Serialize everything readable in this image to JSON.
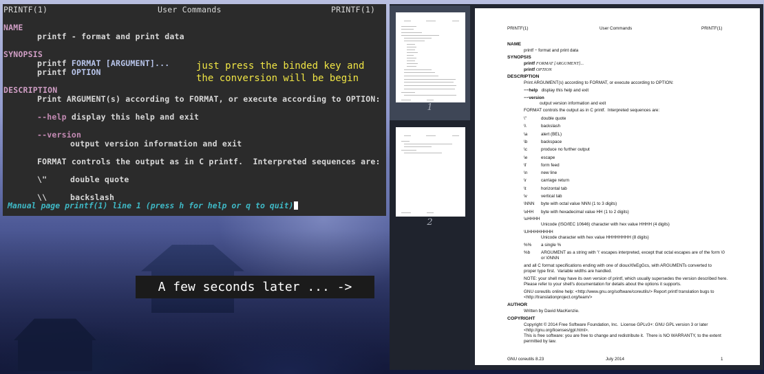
{
  "terminal": {
    "header_left": "PRINTF(1)",
    "header_mid": "User Commands",
    "header_right": "PRINTF(1)",
    "name_heading": "NAME",
    "name_text": "printf - format and print data",
    "synopsis_heading": "SYNOPSIS",
    "synopsis_cmd1": "printf",
    "synopsis_arg1a": "FORMAT",
    "synopsis_arg1b": "[ARGUMENT]...",
    "synopsis_cmd2": "printf",
    "synopsis_arg2": "OPTION",
    "description_heading": "DESCRIPTION",
    "description_text": "Print ARGUMENT(s) according to FORMAT, or execute according to OPTION:",
    "help_opt": "--help",
    "help_text": "display this help and exit",
    "version_opt": "--version",
    "version_text": "output version information and exit",
    "format_text": "FORMAT controls the output as in C printf.  Interpreted sequences are:",
    "seq1_code": "\\\"",
    "seq1_text": "double quote",
    "seq2_code": "\\\\",
    "seq2_text": "backslash",
    "status": "Manual page printf(1) line 1 (press h for help or q to quit)"
  },
  "overlay_note": "just press the binded key and\nthe conversion will be begin",
  "later_banner": "A few seconds later ... ->",
  "viewer": {
    "thumb1_label": "1",
    "thumb2_label": "2",
    "page": {
      "header_left": "PRINTF(1)",
      "header_mid": "User Commands",
      "header_right": "PRINTF(1)",
      "name_h": "NAME",
      "name_t": "printf − format and print data",
      "syn_h": "SYNOPSIS",
      "syn_1a": "printf",
      "syn_1b": "FORMAT [ARGUMENT]...",
      "syn_2a": "printf",
      "syn_2b": "OPTION",
      "desc_h": "DESCRIPTION",
      "desc_t": "Print ARGUMENT(s) according to FORMAT, or execute according to OPTION:",
      "help_o": "−−help",
      "help_t": "display this help and exit",
      "ver_o": "−−version",
      "ver_t": "output version information and exit",
      "fmt_t": "FORMAT controls the output as in C printf.  Interpreted sequences are:",
      "seqs": [
        {
          "code": "\\\"",
          "text": "double quote"
        },
        {
          "code": "\\\\",
          "text": "backslash"
        },
        {
          "code": "\\a",
          "text": "alert (BEL)"
        },
        {
          "code": "\\b",
          "text": "backspace"
        },
        {
          "code": "\\c",
          "text": "produce no further output"
        },
        {
          "code": "\\e",
          "text": "escape"
        },
        {
          "code": "\\f",
          "text": "form feed"
        },
        {
          "code": "\\n",
          "text": "new line"
        },
        {
          "code": "\\r",
          "text": "carriage return"
        },
        {
          "code": "\\t",
          "text": "horizontal tab"
        },
        {
          "code": "\\v",
          "text": "vertical tab"
        },
        {
          "code": "\\NNN",
          "text": "byte with octal value NNN (1 to 3 digits)"
        },
        {
          "code": "\\xHH",
          "text": "byte with hexadecimal value HH (1 to 2 digits)"
        }
      ],
      "u4_code": "\\uHHHH",
      "u4_text": "Unicode (ISO/IEC 10646) character with hex value HHHH (4 digits)",
      "u8_code": "\\UHHHHHHHH",
      "u8_text": "Unicode character with hex value HHHHHHHH (8 digits)",
      "pct_code": "%%",
      "pct_text": "a single %",
      "pb_code": "%b",
      "pb_text1": "ARGUMENT as a string with '\\' escapes interpreted, except that octal escapes are of the form \\0",
      "pb_text2": "or \\0NNN",
      "allc_1": "and all C format specifications ending with one of diouxXfeEgGcs, with ARGUMENTs converted to",
      "allc_2": "proper type first.  Variable widths are handled.",
      "note_1": "NOTE: your shell may have its own version of printf, which usually supersedes the version described here.",
      "note_2": "Please refer to your shell's documentation for details about the options it supports.",
      "gnu_1": "GNU coreutils online help: <http://www.gnu.org/software/coreutils/> Report printf translation bugs to",
      "gnu_2": "<http://translationproject.org/team/>",
      "author_h": "AUTHOR",
      "author_t": "Written by David MacKenzie.",
      "copy_h": "COPYRIGHT",
      "copy_1": "Copyright © 2014 Free Software Foundation, Inc.  License GPLv3+: GNU GPL version 3 or later",
      "copy_2": "<http://gnu.org/licenses/gpl.html>.",
      "copy_3": "This is free software: you are free to change and redistribute it.  There is NO WARRANTY, to the extent",
      "copy_4": "permitted by law.",
      "footer_left": "GNU coreutils 8.23",
      "footer_mid": "July 2014",
      "footer_right": "1"
    }
  }
}
